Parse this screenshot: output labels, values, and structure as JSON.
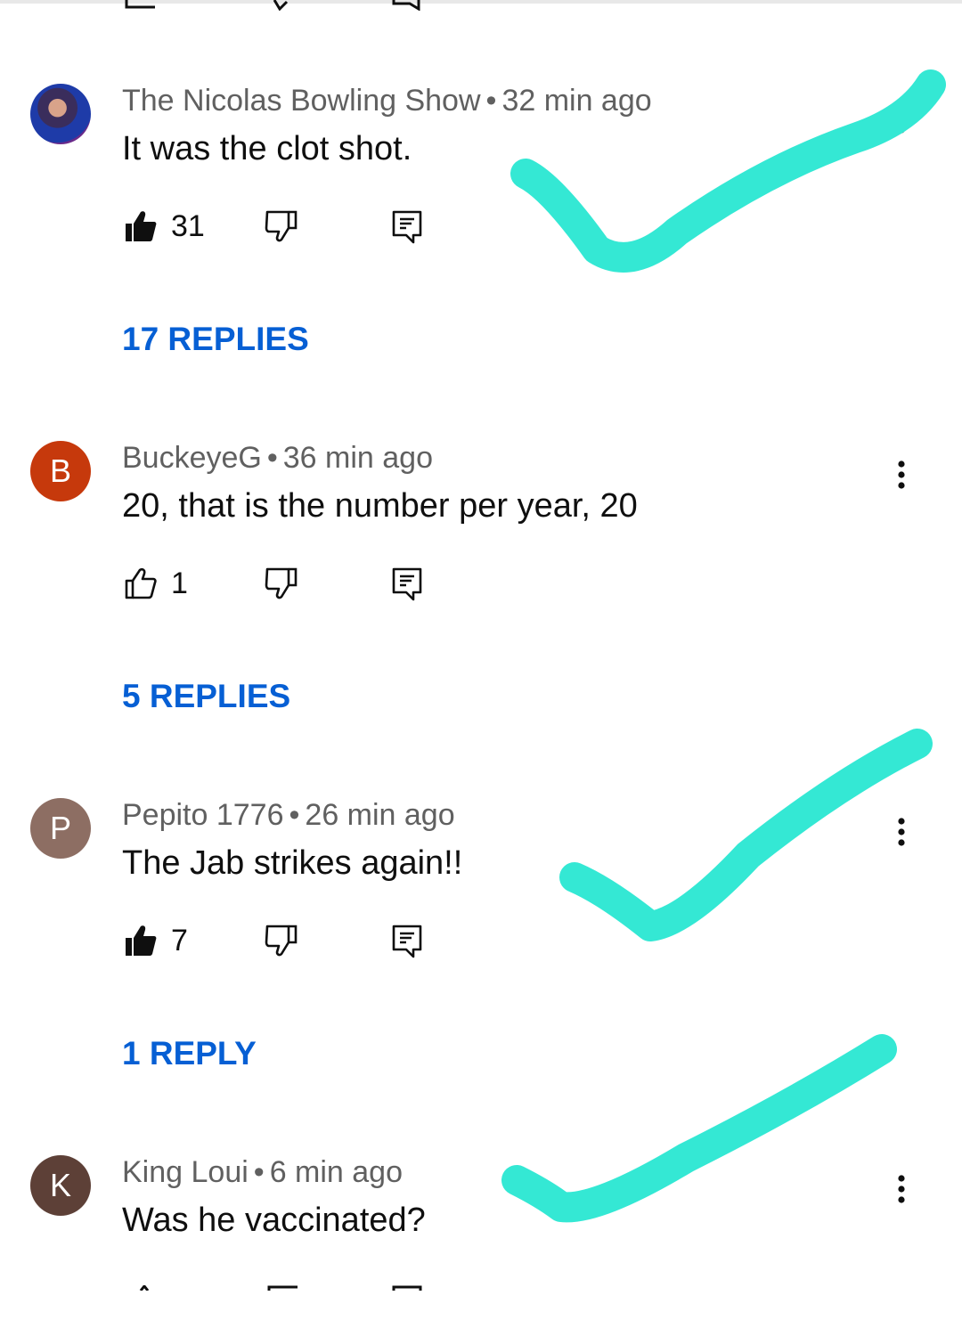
{
  "colors": {
    "reply_link": "#065fd4",
    "meta_text": "#606060",
    "checkmark": "#34e8d4"
  },
  "comments": [
    {
      "author": "The Nicolas Bowling Show",
      "time": "32 min ago",
      "text": "It was the clot shot.",
      "likes": "31",
      "liked": true,
      "replies_label": "17 REPLIES",
      "avatar_letter": "",
      "avatar_color": "#2b2b6a",
      "checkmark": true
    },
    {
      "author": "BuckeyeG",
      "time": "36 min ago",
      "text": "20, that is the number per year, 20",
      "likes": "1",
      "liked": false,
      "replies_label": "5 REPLIES",
      "avatar_letter": "B",
      "avatar_color": "#c6390c",
      "checkmark": false
    },
    {
      "author": "Pepito 1776",
      "time": "26 min ago",
      "text": "The Jab strikes again!!",
      "likes": "7",
      "liked": true,
      "replies_label": "1 REPLY",
      "avatar_letter": "P",
      "avatar_color": "#8d6e63",
      "checkmark": true
    },
    {
      "author": "King Loui",
      "time": "6 min ago",
      "text": "Was he vaccinated?",
      "likes": "",
      "liked": false,
      "replies_label": "",
      "avatar_letter": "K",
      "avatar_color": "#5d4037",
      "checkmark": true
    }
  ],
  "icons": {
    "like": "thumbs-up-icon",
    "dislike": "thumbs-down-icon",
    "reply": "reply-comment-icon",
    "more": "more-vertical-icon"
  }
}
